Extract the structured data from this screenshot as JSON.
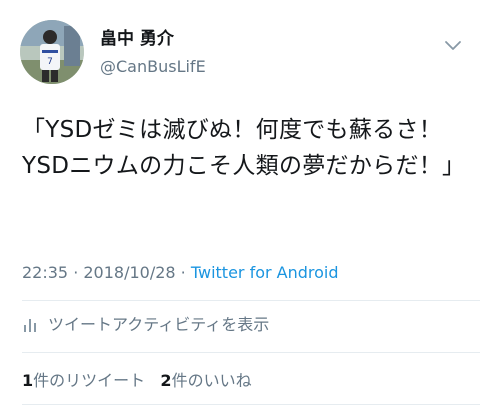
{
  "user": {
    "display_name": "畠中 勇介",
    "handle": "@CanBusLifE"
  },
  "tweet": {
    "text": "「YSDゼミは滅びぬ！何度でも蘇るさ！YSDニウムの力こそ人類の夢だからだ！」",
    "time": "22:35",
    "separator": " · ",
    "date": "2018/10/28",
    "source": "Twitter for Android"
  },
  "activity": {
    "label": "ツイートアクティビティを表示"
  },
  "stats": {
    "retweets_count": "1",
    "retweets_label": "件のリツイート",
    "likes_count": "2",
    "likes_label": "件のいいね"
  },
  "icons": {
    "menu": "chevron-down-icon",
    "activity": "bar-chart-icon"
  },
  "colors": {
    "link": "#1b95e0",
    "secondary_text": "#657786",
    "divider": "#e6ecf0"
  }
}
